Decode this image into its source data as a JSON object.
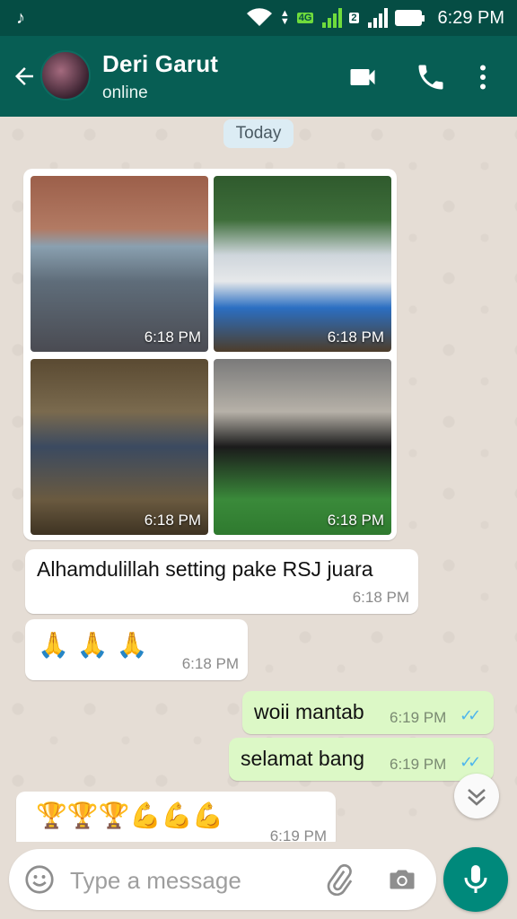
{
  "status_bar": {
    "time": "6:29 PM",
    "app_icon": "tiktok-icon",
    "sim1_label": "4G",
    "sim2_label": "2"
  },
  "header": {
    "contact_name": "Deri Garut",
    "contact_status": "online",
    "icons": [
      "back-arrow-icon",
      "video-call-icon",
      "phone-icon",
      "more-vert-icon"
    ]
  },
  "chat": {
    "date_chip": "Today",
    "album": {
      "photos": [
        {
          "time": "6:18 PM"
        },
        {
          "time": "6:18 PM"
        },
        {
          "time": "6:18 PM"
        },
        {
          "time": "6:18 PM"
        }
      ]
    },
    "messages": [
      {
        "direction": "in",
        "text": "Alhamdulillah setting pake RSJ juara",
        "time": "6:18 PM"
      },
      {
        "direction": "in",
        "emoji": "🙏 🙏 🙏",
        "time": "6:18 PM"
      },
      {
        "direction": "out",
        "text": "woii mantab",
        "time": "6:19 PM",
        "status": "read"
      },
      {
        "direction": "out",
        "text": "selamat bang",
        "time": "6:19 PM",
        "status": "read"
      },
      {
        "direction": "in",
        "emoji": "🏆🏆🏆💪💪💪",
        "time": "6:19 PM"
      }
    ]
  },
  "composer": {
    "placeholder": "Type a message"
  },
  "colors": {
    "header": "#075e54",
    "status_bar": "#054d44",
    "outgoing_bubble": "#dcf8c6",
    "read_ticks": "#4fb6ec",
    "fab": "#00897b"
  }
}
